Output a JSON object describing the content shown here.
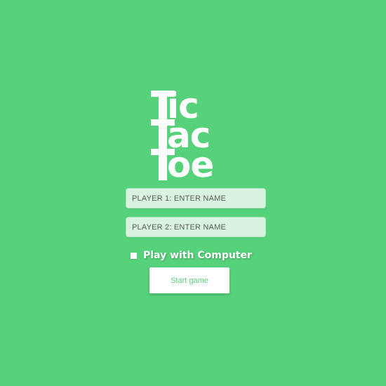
{
  "app": {
    "title": "Tic Tac Toe",
    "logo_lines": [
      "ic",
      "ac",
      "oe"
    ]
  },
  "form": {
    "player1_placeholder": "PLAYER 1: ENTER NAME",
    "player1_value": "",
    "player2_placeholder": "PLAYER 2: ENTER NAME",
    "player2_value": "",
    "computer_label": "Play with Computer",
    "computer_checked": false,
    "start_label": "Start game"
  },
  "colors": {
    "background": "#56d27b",
    "input_background": "#d8f4e1",
    "button_text": "#56d27b",
    "logo": "#ffffff"
  },
  "icons": [
    "checkbox-icon"
  ]
}
